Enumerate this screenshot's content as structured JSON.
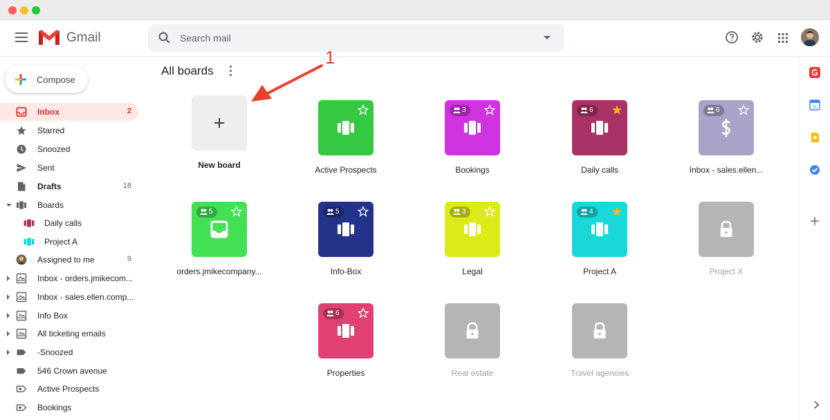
{
  "app": {
    "name": "Gmail",
    "search_placeholder": "Search mail"
  },
  "compose": {
    "label": "Compose"
  },
  "sidebar": {
    "items": [
      {
        "name": "inbox",
        "label": "Inbox",
        "count": "2",
        "icon": "inbox-icon"
      },
      {
        "name": "starred",
        "label": "Starred",
        "count": "",
        "icon": "star-icon"
      },
      {
        "name": "snoozed",
        "label": "Snoozed",
        "count": "",
        "icon": "clock-icon"
      },
      {
        "name": "sent",
        "label": "Sent",
        "count": "",
        "icon": "send-icon"
      },
      {
        "name": "drafts",
        "label": "Drafts",
        "count": "18",
        "icon": "draft-icon"
      },
      {
        "name": "boards",
        "label": "Boards",
        "count": "",
        "icon": "boards-icon"
      },
      {
        "name": "daily-calls",
        "label": "Daily calls",
        "count": "",
        "icon": "board-icon"
      },
      {
        "name": "project-a",
        "label": "Project A",
        "count": "",
        "icon": "board-icon"
      },
      {
        "name": "assigned-to-me",
        "label": "Assigned to me",
        "count": "9",
        "icon": "avatar-icon"
      },
      {
        "name": "inbox-orders",
        "label": "Inbox - orders.jmikecom...",
        "count": "",
        "icon": "shared-inbox-icon"
      },
      {
        "name": "inbox-sales",
        "label": "Inbox - sales.ellen.comp...",
        "count": "",
        "icon": "shared-inbox-icon"
      },
      {
        "name": "info-box",
        "label": "Info Box",
        "count": "",
        "icon": "shared-inbox-icon"
      },
      {
        "name": "all-ticketing",
        "label": "All ticketing emails",
        "count": "",
        "icon": "shared-inbox-icon"
      },
      {
        "name": "snoozed-label",
        "label": "-Snoozed",
        "count": "",
        "icon": "label-icon"
      },
      {
        "name": "crown-avenue",
        "label": "546 Crown avenue",
        "count": "",
        "icon": "label-icon"
      },
      {
        "name": "active-prospects",
        "label": "Active Prospects",
        "count": "",
        "icon": "board-label-icon"
      },
      {
        "name": "bookings",
        "label": "Bookings",
        "count": "",
        "icon": "board-label-icon"
      }
    ]
  },
  "main": {
    "title": "All boards",
    "new_board_label": "New board",
    "annotation_number": "1",
    "boards": [
      {
        "name": "Active Prospects",
        "color": "#34c940",
        "members": "",
        "starred": false,
        "icon": "board-icon",
        "locked": false
      },
      {
        "name": "Bookings",
        "color": "#d033e0",
        "members": "3",
        "starred": false,
        "icon": "board-icon",
        "locked": false
      },
      {
        "name": "Daily calls",
        "color": "#a93266",
        "members": "6",
        "starred": true,
        "icon": "board-icon",
        "locked": false
      },
      {
        "name": "Inbox - sales.ellen...",
        "color": "#a9a3c9",
        "members": "6",
        "starred": false,
        "icon": "dollar-icon",
        "locked": false
      },
      {
        "name": "orders.jmikecompany...",
        "color": "#43e055",
        "members": "5",
        "starred": false,
        "icon": "inbox-icon",
        "locked": false
      },
      {
        "name": "Info-Box",
        "color": "#23338a",
        "members": "5",
        "starred": false,
        "icon": "board-icon",
        "locked": false
      },
      {
        "name": "Legal",
        "color": "#dbea18",
        "members": "3",
        "starred": false,
        "icon": "board-icon",
        "locked": false
      },
      {
        "name": "Project A",
        "color": "#1ad8d8",
        "members": "4",
        "starred": true,
        "icon": "board-icon",
        "locked": false
      },
      {
        "name": "Project X",
        "color": "#b5b5b5",
        "members": "",
        "starred": false,
        "icon": "lock-icon",
        "locked": true
      },
      {
        "name": "Properties",
        "color": "#df4272",
        "members": "6",
        "starred": false,
        "icon": "board-icon",
        "locked": false
      },
      {
        "name": "Real estate",
        "color": "#b5b5b5",
        "members": "",
        "starred": false,
        "icon": "lock-icon",
        "locked": true
      },
      {
        "name": "Travel agencies",
        "color": "#b5b5b5",
        "members": "",
        "starred": false,
        "icon": "lock-icon",
        "locked": true
      }
    ]
  },
  "colors": {
    "accent_red": "#d93025",
    "annotation": "#e8412c",
    "star_gold": "#f6b61d"
  }
}
